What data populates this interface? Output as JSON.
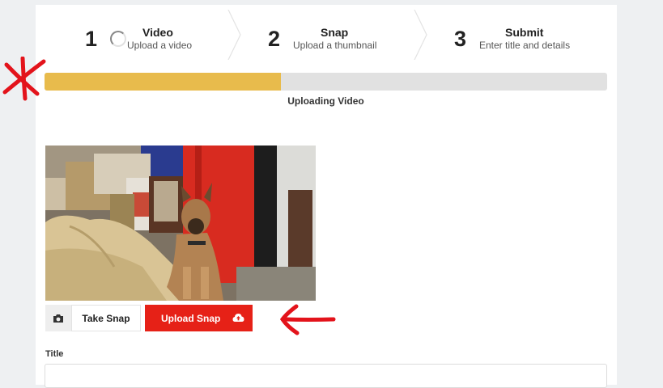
{
  "steps": [
    {
      "number": "1",
      "title": "Video",
      "subtitle": "Upload a video"
    },
    {
      "number": "2",
      "title": "Snap",
      "subtitle": "Upload a thumbnail"
    },
    {
      "number": "3",
      "title": "Submit",
      "subtitle": "Enter title and details"
    }
  ],
  "upload": {
    "progress_fraction": 0.42,
    "status": "Uploading Video"
  },
  "snap": {
    "take_label": "Take Snap",
    "upload_label": "Upload Snap"
  },
  "form": {
    "title_label": "Title",
    "title_value": ""
  },
  "colors": {
    "accent_red": "#e62117",
    "progress_yellow": "#e8bb4c",
    "annotation_red": "#e3131b"
  },
  "icons": [
    "loading-spinner-icon",
    "camera-icon",
    "cloud-upload-icon",
    "chevron-right-icon"
  ]
}
